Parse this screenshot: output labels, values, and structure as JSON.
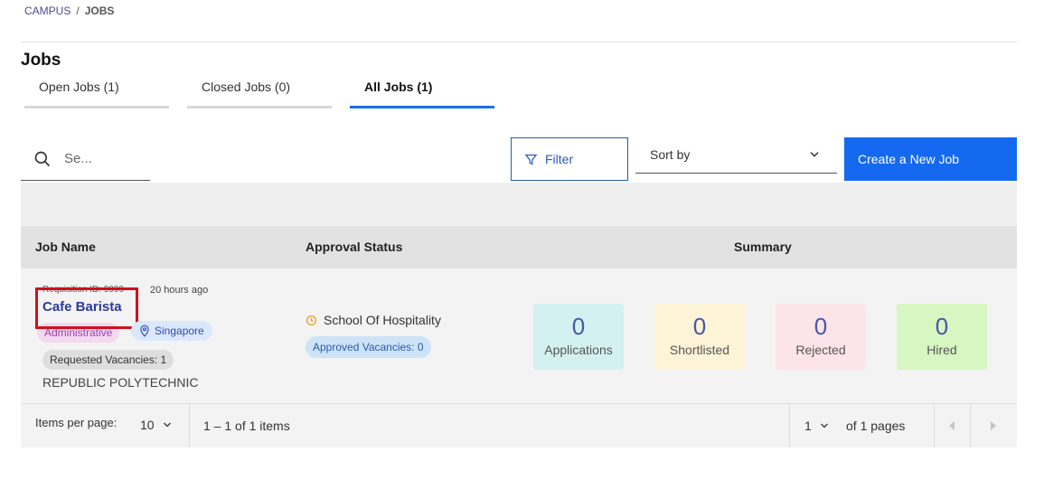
{
  "breadcrumb": {
    "root": "CAMPUS",
    "separator": "/",
    "current": "JOBS"
  },
  "page": {
    "title": "Jobs"
  },
  "tabs": [
    {
      "label": "Open Jobs (1)"
    },
    {
      "label": "Closed Jobs (0)"
    },
    {
      "label": "All Jobs (1)",
      "active": true
    }
  ],
  "toolbar": {
    "search_placeholder": "Se...",
    "filter_label": "Filter",
    "sort_label": "Sort by",
    "create_label": "Create a New Job"
  },
  "table": {
    "headers": {
      "job_name": "Job Name",
      "approval_status": "Approval Status",
      "summary": "Summary"
    },
    "rows": [
      {
        "requisition_id": "Requisition ID: 9999",
        "time_ago": "20 hours ago",
        "job_name": "Cafe Barista",
        "category": "Administrative",
        "location": "Singapore",
        "requested_vacancies": "Requested Vacancies: 1",
        "organization": "REPUBLIC POLYTECHNIC",
        "approval_school": "School Of Hospitality",
        "approved_vacancies": "Approved Vacancies: 0",
        "summary": {
          "applications": {
            "value": "0",
            "label": "Applications"
          },
          "shortlisted": {
            "value": "0",
            "label": "Shortlisted"
          },
          "rejected": {
            "value": "0",
            "label": "Rejected"
          },
          "hired": {
            "value": "0",
            "label": "Hired"
          }
        }
      }
    ]
  },
  "paginator": {
    "items_per_page_label": "Items per page:",
    "page_size": "10",
    "range_label": "1 – 1 of 1 items",
    "current_page": "1",
    "of_pages": "of 1 pages"
  },
  "colors": {
    "accent": "#1469f0",
    "highlight_box": "#d0101c"
  }
}
